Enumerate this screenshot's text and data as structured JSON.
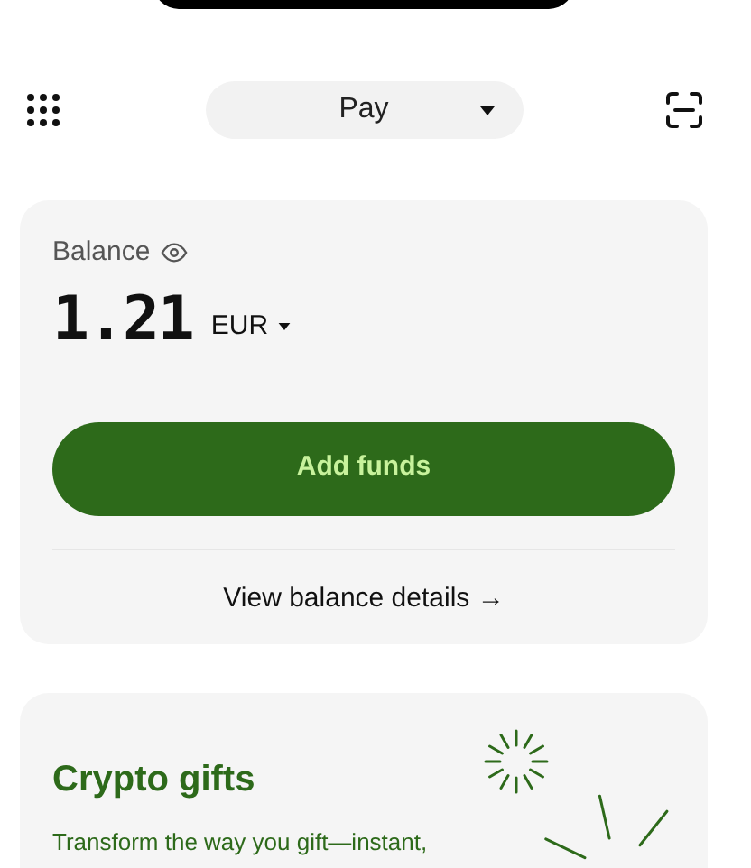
{
  "mode_selector": {
    "label": "Pay"
  },
  "balance": {
    "label": "Balance",
    "amount": "1.21",
    "currency": "EUR",
    "action": "Add funds",
    "details_link": "View balance details →"
  },
  "promo": {
    "title": "Crypto gifts",
    "text": "Transform the way you gift—instant,"
  }
}
